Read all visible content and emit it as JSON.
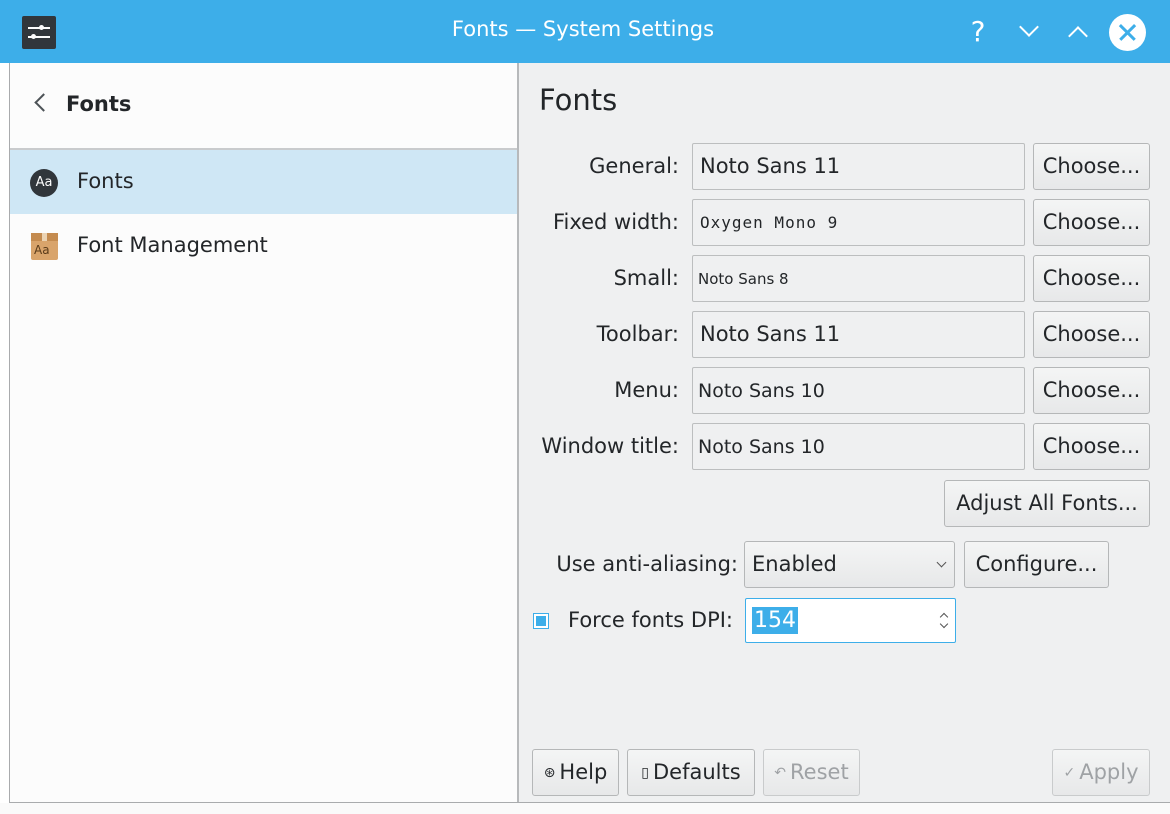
{
  "window": {
    "title": "Fonts — System Settings",
    "help_glyph": "?"
  },
  "sidebar": {
    "title": "Fonts",
    "items": [
      {
        "label": "Fonts",
        "icon": "fonts-aa-icon",
        "selected": true
      },
      {
        "label": "Font Management",
        "icon": "font-management-box-icon",
        "selected": false
      }
    ]
  },
  "page": {
    "title": "Fonts",
    "font_rows": [
      {
        "label": "General:",
        "value": "Noto Sans 11",
        "button": "Choose..."
      },
      {
        "label": "Fixed width:",
        "value": "Oxygen Mono 9",
        "button": "Choose..."
      },
      {
        "label": "Small:",
        "value": "Noto Sans 8",
        "button": "Choose..."
      },
      {
        "label": "Toolbar:",
        "value": "Noto Sans 11",
        "button": "Choose..."
      },
      {
        "label": "Menu:",
        "value": "Noto Sans 10",
        "button": "Choose..."
      },
      {
        "label": "Window title:",
        "value": "Noto Sans 10",
        "button": "Choose..."
      }
    ],
    "adjust_all_label": "Adjust All Fonts...",
    "antialias": {
      "label": "Use anti-aliasing:",
      "value": "Enabled",
      "configure_label": "Configure..."
    },
    "dpi": {
      "label": "Force fonts DPI:",
      "checked": true,
      "value": "154"
    }
  },
  "footer": {
    "help_label": "Help",
    "defaults_label": "Defaults",
    "reset_label": "Reset",
    "apply_label": "Apply"
  },
  "colors": {
    "accent": "#3daee9",
    "selection": "#cfe7f5",
    "window_bg": "#eff0f1",
    "text": "#232629"
  }
}
